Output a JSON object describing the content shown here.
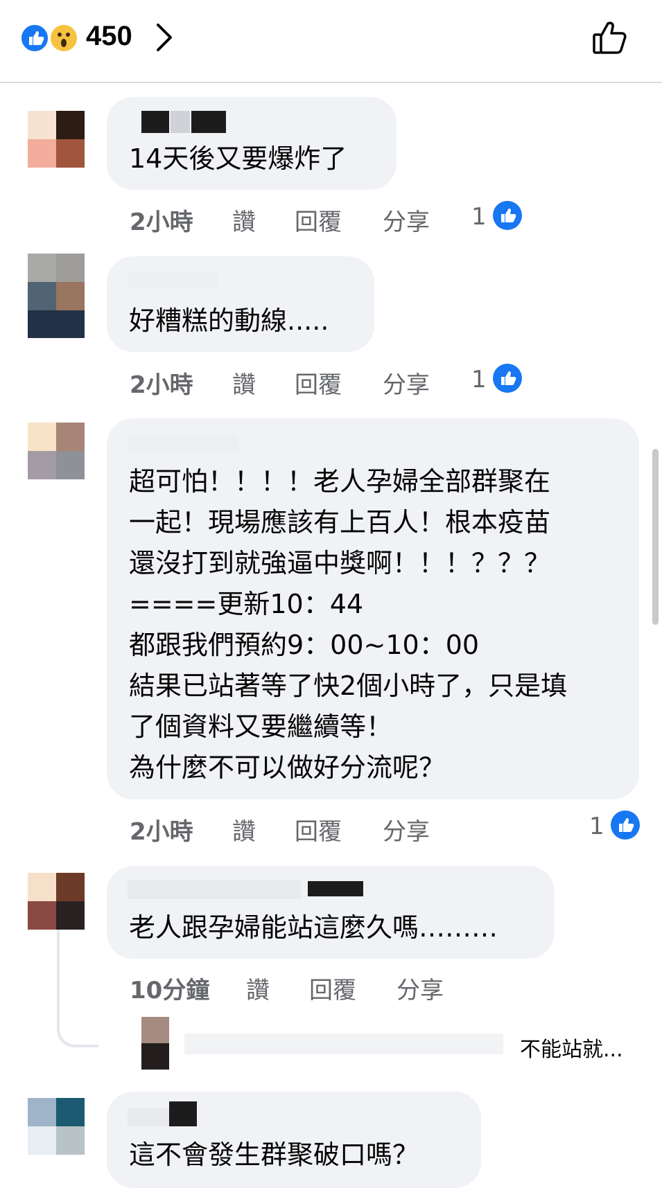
{
  "header": {
    "reaction_count": "450",
    "reactions": [
      "like-icon",
      "wow-icon"
    ]
  },
  "comments": [
    {
      "text": "14天後又要爆炸了",
      "time": "2小時",
      "like": "讚",
      "reply": "回覆",
      "share": "分享",
      "likes": "1"
    },
    {
      "text": "好糟糕的動線.....",
      "time": "2小時",
      "like": "讚",
      "reply": "回覆",
      "share": "分享",
      "likes": "1"
    },
    {
      "lines": [
        "超可怕！！！！老人孕婦全部群聚在",
        "一起！現場應該有上百人！根本疫苗",
        "還沒打到就強逼中獎啊！！！？？？",
        "====更新10：44",
        "都跟我們預約9：00~10：00",
        "結果已站著等了快2個小時了，只是填",
        "了個資料又要繼續等！",
        "為什麼不可以做好分流呢？"
      ],
      "time": "2小時",
      "like": "讚",
      "reply": "回覆",
      "share": "分享",
      "likes": "1"
    },
    {
      "text": "老人跟孕婦能站這麼久嗎………",
      "time": "10分鐘",
      "like": "讚",
      "reply": "回覆",
      "share": "分享",
      "reply_preview": "不能站就..."
    },
    {
      "text": "這不會發生群聚破口嗎？"
    }
  ],
  "colors": {
    "bubble": "#f0f2f5",
    "meta": "#65676b",
    "accent": "#1877f2",
    "text": "#050505"
  }
}
